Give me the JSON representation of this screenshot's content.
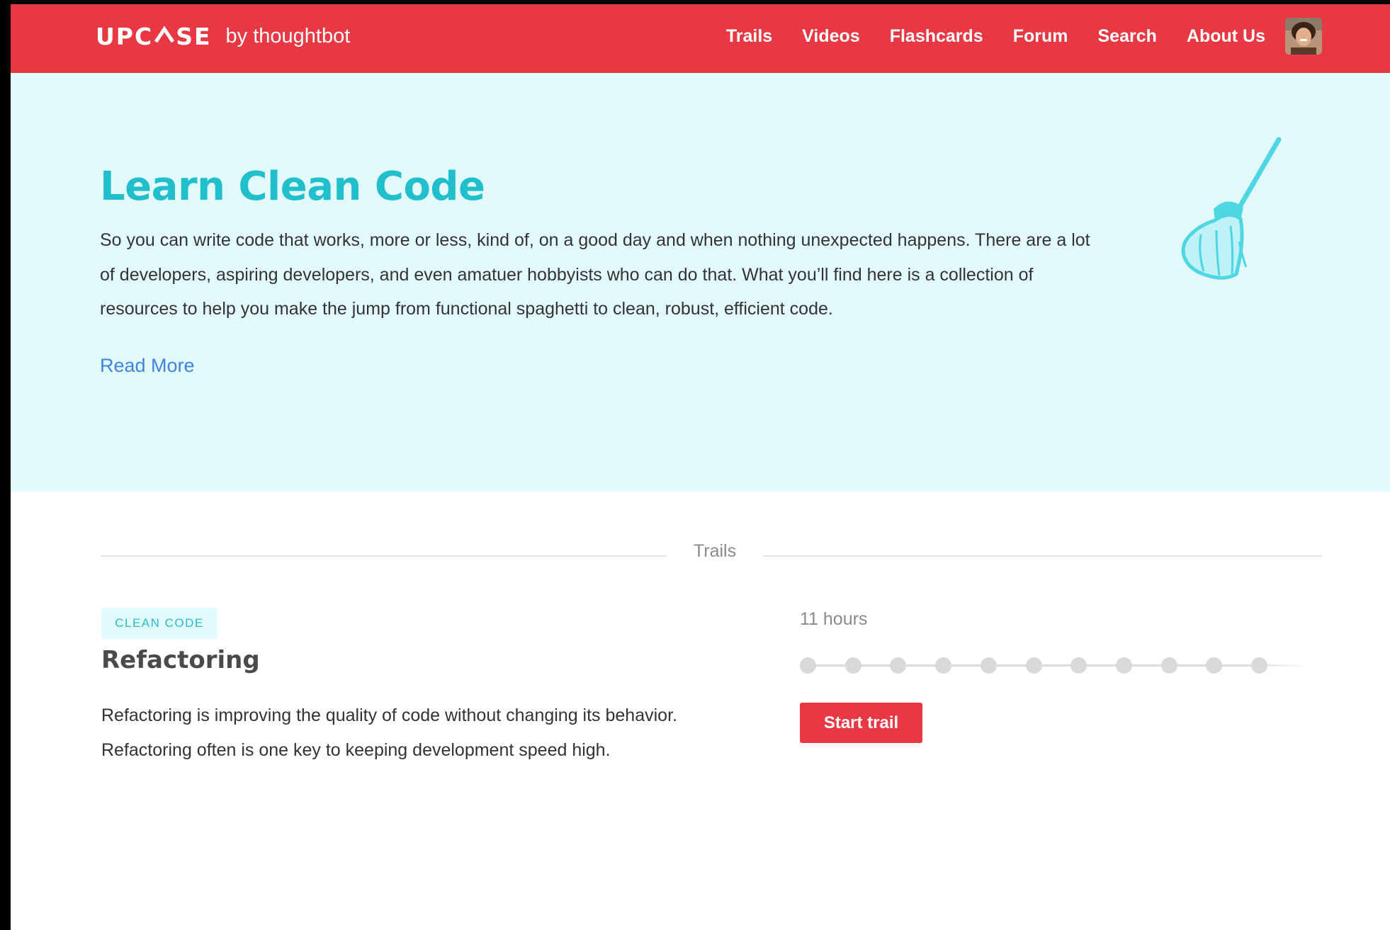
{
  "header": {
    "logo_left": "UPC",
    "logo_right": "SE",
    "logo_by": "by thoughtbot",
    "nav": [
      {
        "label": "Trails"
      },
      {
        "label": "Videos"
      },
      {
        "label": "Flashcards"
      },
      {
        "label": "Forum"
      },
      {
        "label": "Search"
      },
      {
        "label": "About Us"
      }
    ],
    "avatar_icon": "user-avatar"
  },
  "hero": {
    "title": "Learn Clean Code",
    "body": "So you can write code that works, more or less, kind of, on a good day and when nothing unexpected happens. There are a lot of developers, aspiring developers, and even amatuer hobbyists who can do that. What you’ll find here is a collection of resources to help you make the jump from functional spaghetti to clean, robust, efficient code.",
    "read_more": "Read More",
    "illustration_icon": "broom-icon"
  },
  "trails_section": {
    "heading": "Trails",
    "trail": {
      "badge": "CLEAN CODE",
      "title": "Refactoring",
      "description": "Refactoring is improving the quality of code without changing its behavior. Refactoring often is one key to keeping development speed high.",
      "duration": "11 hours",
      "step_count": 11,
      "start_label": "Start trail"
    }
  },
  "colors": {
    "brand_red": "#e83844",
    "hero_bg": "#e3fafd",
    "accent_teal": "#21bfcb",
    "link_blue": "#3c84e0",
    "step_gray": "#d9d9d9"
  }
}
